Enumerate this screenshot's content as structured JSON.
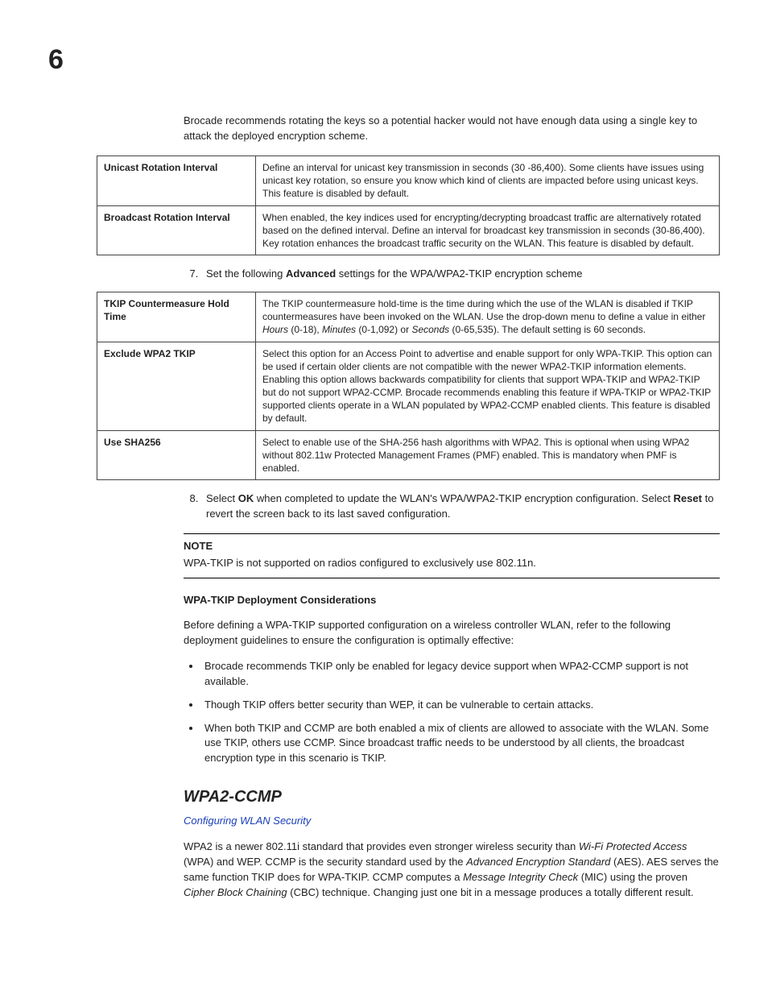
{
  "chapter": "6",
  "intro": "Brocade recommends rotating the keys so a potential hacker would not have enough data using a single key to attack the deployed encryption scheme.",
  "table1": {
    "rows": [
      {
        "label": "Unicast Rotation Interval",
        "desc": "Define an interval for unicast key transmission in seconds (30 -86,400). Some clients have issues using unicast key rotation, so ensure you know which kind of clients are impacted before using unicast keys. This feature is disabled by default."
      },
      {
        "label": "Broadcast Rotation Interval",
        "desc": "When enabled, the key indices used for encrypting/decrypting broadcast traffic are alternatively rotated based on the defined interval. Define an interval for broadcast key transmission in seconds (30-86,400). Key rotation enhances the broadcast traffic security on the WLAN. This feature is disabled by default."
      }
    ]
  },
  "step7": {
    "num": "7.",
    "pre": "Set the following ",
    "bold": "Advanced",
    "post": " settings for the WPA/WPA2-TKIP encryption scheme"
  },
  "table2": {
    "rows": [
      {
        "label": "TKIP Countermeasure Hold Time",
        "desc_parts": [
          {
            "t": "The TKIP countermeasure hold-time is the time during which the use of the WLAN is disabled if TKIP countermeasures have been invoked on the WLAN. Use the drop-down menu to define a value in either "
          },
          {
            "t": "Hours",
            "i": true
          },
          {
            "t": " (0-18), "
          },
          {
            "t": "Minutes",
            "i": true
          },
          {
            "t": " (0-1,092) or "
          },
          {
            "t": "Seconds",
            "i": true
          },
          {
            "t": " (0-65,535). The default setting is 60 seconds."
          }
        ]
      },
      {
        "label": "Exclude WPA2 TKIP",
        "desc_parts": [
          {
            "t": "Select this option for an Access Point to advertise and enable support for only WPA-TKIP. This option can be used if certain older clients are not compatible with the newer WPA2-TKIP information elements. Enabling this option allows backwards compatibility for clients that support WPA-TKIP and WPA2-TKIP but do not support WPA2-CCMP. Brocade recommends enabling this feature if WPA-TKIP or WPA2-TKIP supported clients operate in a WLAN populated by WPA2-CCMP enabled clients. This feature is disabled by default."
          }
        ]
      },
      {
        "label": "Use SHA256",
        "desc_parts": [
          {
            "t": "Select to enable use of the SHA-256 hash algorithms with WPA2. This is optional when using WPA2 without 802.11w Protected Management Frames (PMF) enabled. This is mandatory when PMF is enabled."
          }
        ]
      }
    ]
  },
  "step8": {
    "num": "8.",
    "parts": [
      {
        "t": "Select "
      },
      {
        "t": "OK",
        "b": true
      },
      {
        "t": " when completed to update the WLAN's WPA/WPA2-TKIP encryption configuration. Select "
      },
      {
        "t": "Reset",
        "b": true
      },
      {
        "t": " to revert the screen back to its last saved configuration."
      }
    ]
  },
  "note": {
    "label": "NOTE",
    "text": "WPA-TKIP is not supported on radios configured to exclusively use 802.11n."
  },
  "deploy": {
    "heading": "WPA-TKIP Deployment Considerations",
    "intro": "Before defining a WPA-TKIP supported configuration on a wireless controller WLAN, refer to the following deployment guidelines to ensure the configuration is optimally effective:",
    "bullets": [
      " Brocade recommends TKIP only be enabled for legacy device support when WPA2-CCMP support is not available.",
      "Though TKIP offers better security than WEP, it can be vulnerable to certain attacks.",
      "When both TKIP and CCMP are both enabled a mix of clients are allowed to associate with the WLAN. Some use TKIP, others use CCMP. Since broadcast traffic needs to be understood by all clients, the broadcast encryption type in this scenario is TKIP."
    ]
  },
  "section": {
    "title": "WPA2-CCMP",
    "link": "Configuring WLAN Security",
    "para_parts": [
      {
        "t": "WPA2 is a newer 802.11i standard that provides even stronger wireless security than "
      },
      {
        "t": "Wi-Fi Protected Access",
        "i": true
      },
      {
        "t": " (WPA) and WEP. CCMP is the security standard used by the "
      },
      {
        "t": "Advanced Encryption Standard",
        "i": true
      },
      {
        "t": " (AES). AES serves the same function TKIP does for WPA-TKIP. CCMP computes a "
      },
      {
        "t": "Message Integrity Check",
        "i": true
      },
      {
        "t": " (MIC) using the proven "
      },
      {
        "t": "Cipher Block Chaining",
        "i": true
      },
      {
        "t": " (CBC) technique. Changing just one bit in a message produces a totally different result."
      }
    ]
  }
}
